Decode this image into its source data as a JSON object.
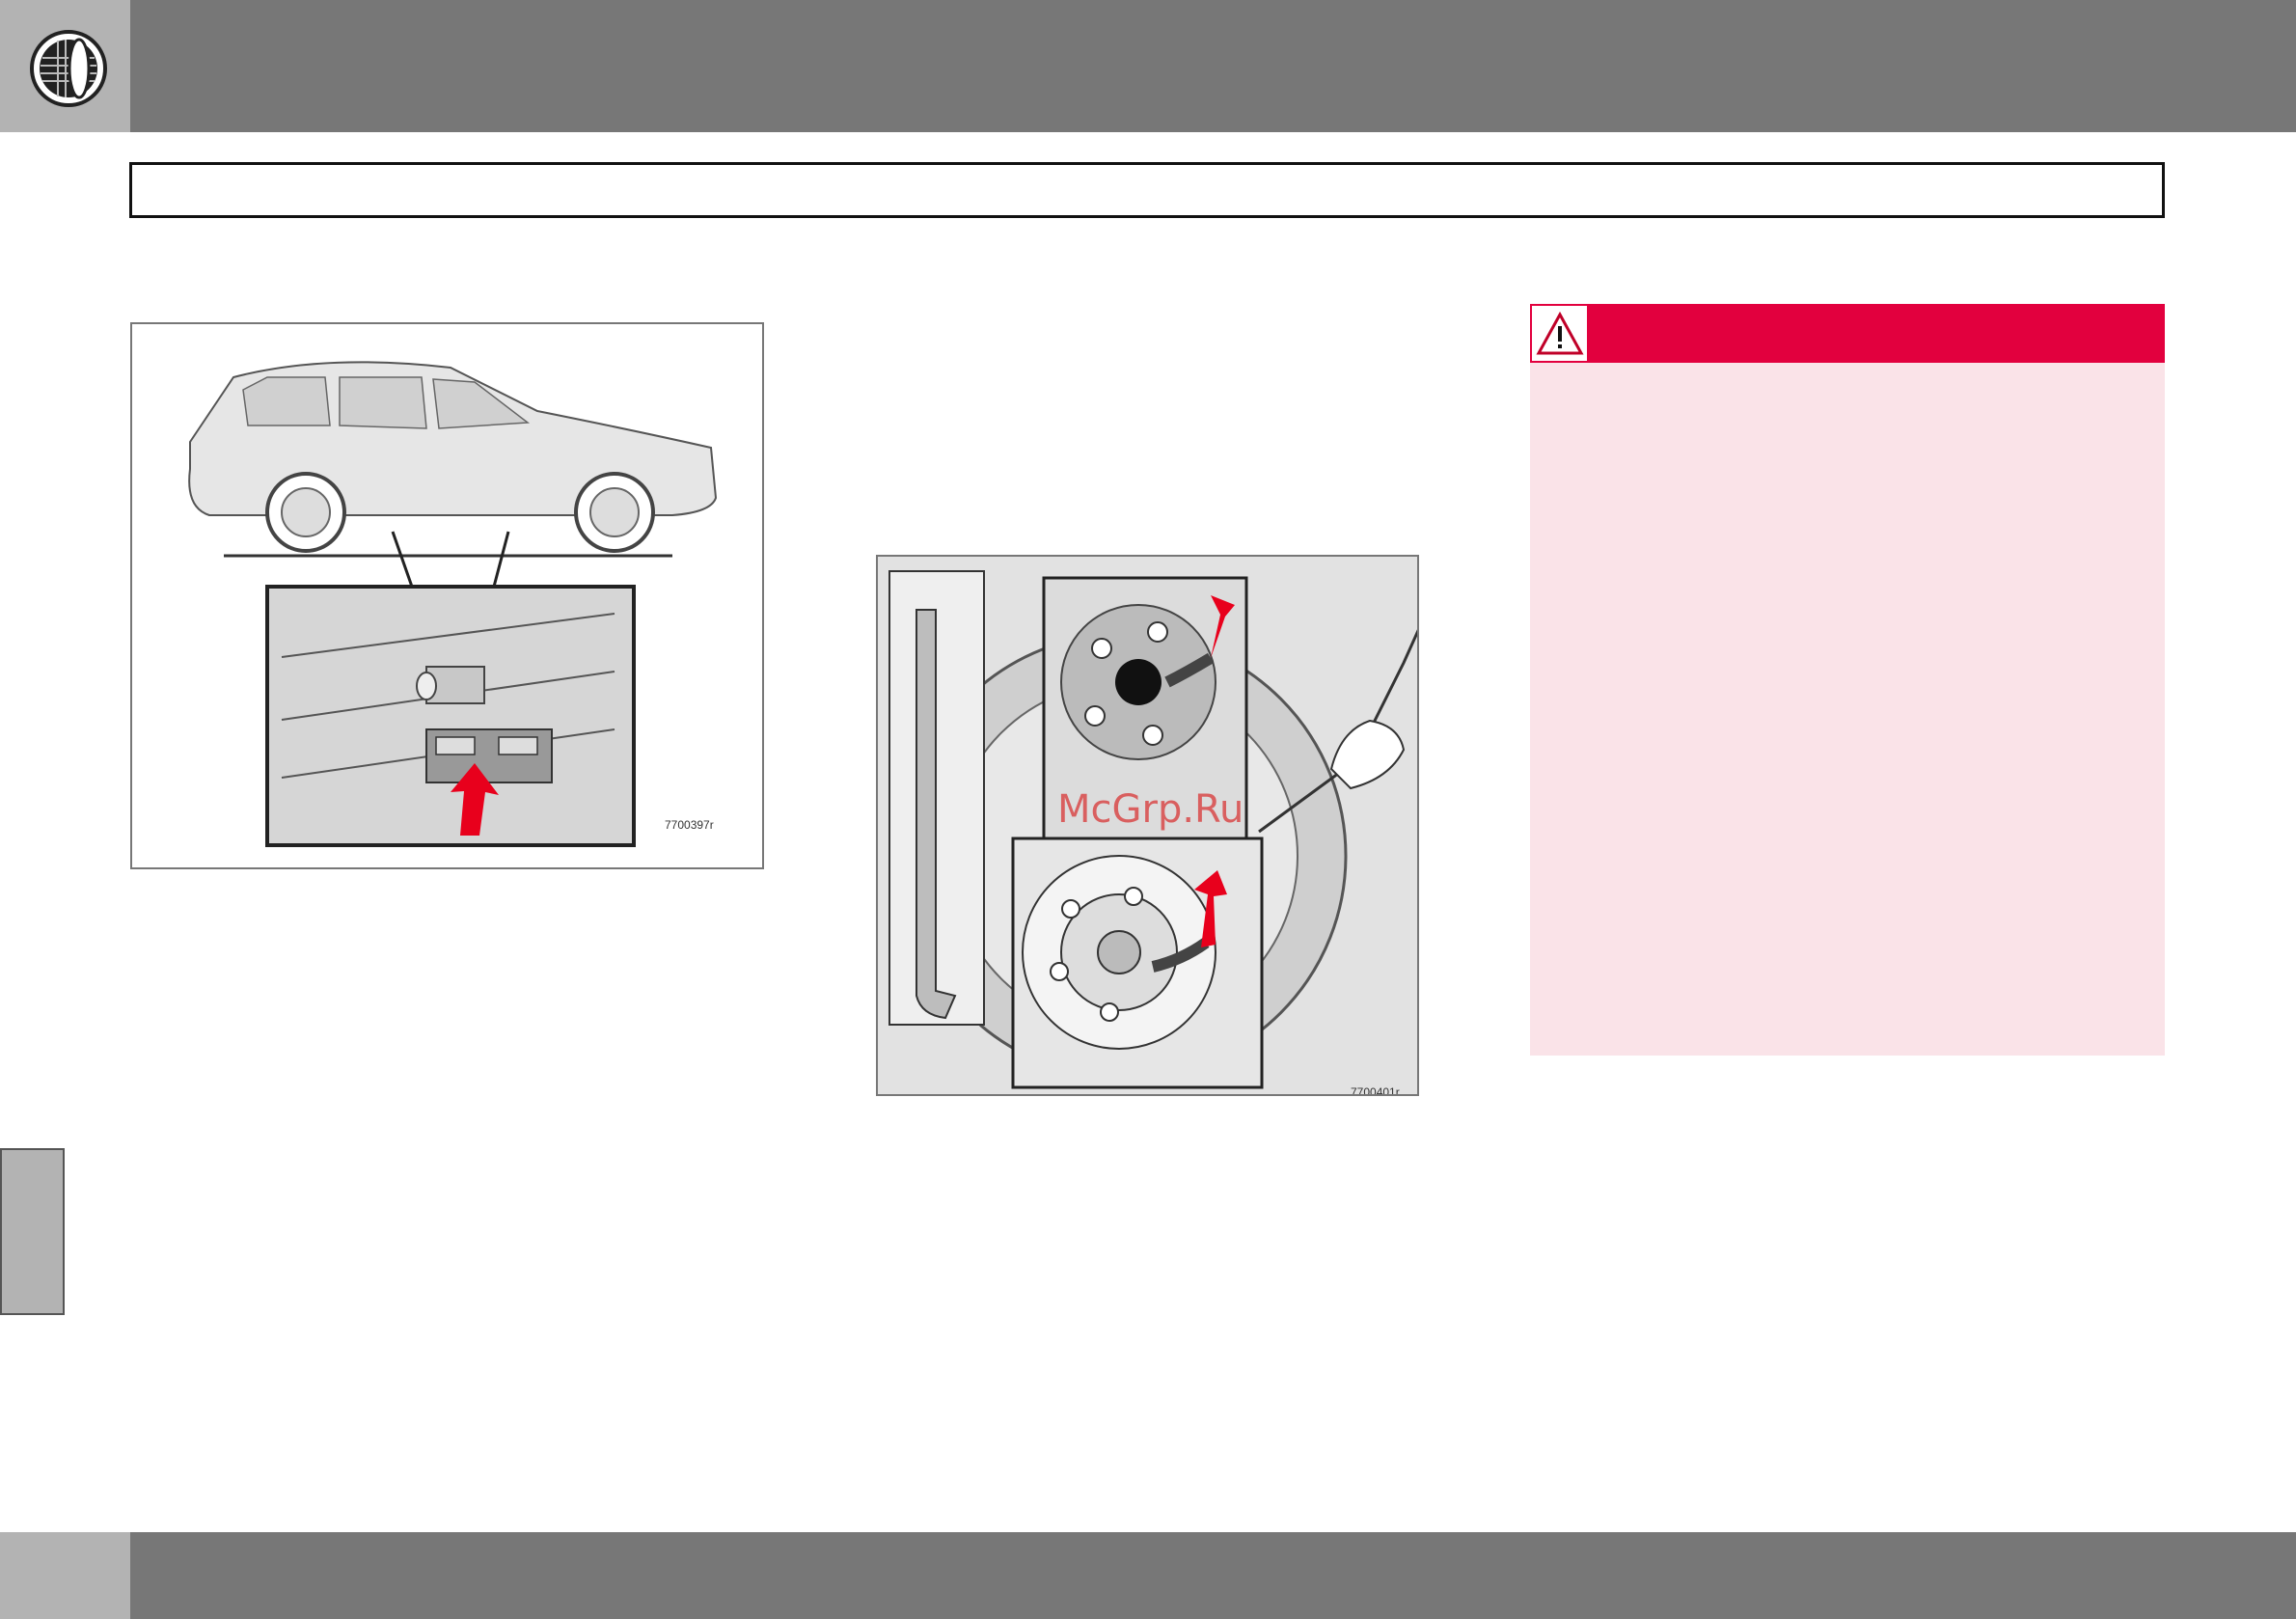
{
  "header": {
    "icon": "tire-icon",
    "title": ""
  },
  "figures": [
    {
      "name": "jacking-point-figure",
      "code": "7700397r"
    },
    {
      "name": "wheel-nut-figure",
      "code": "7700401r"
    }
  ],
  "warning": {
    "icon": "warning-triangle-icon",
    "accent": "#e2003e",
    "background": "#fae3e8"
  },
  "watermark": "McGrp.Ru",
  "colors": {
    "bar": "#777777",
    "tab": "#b3b3b3"
  }
}
